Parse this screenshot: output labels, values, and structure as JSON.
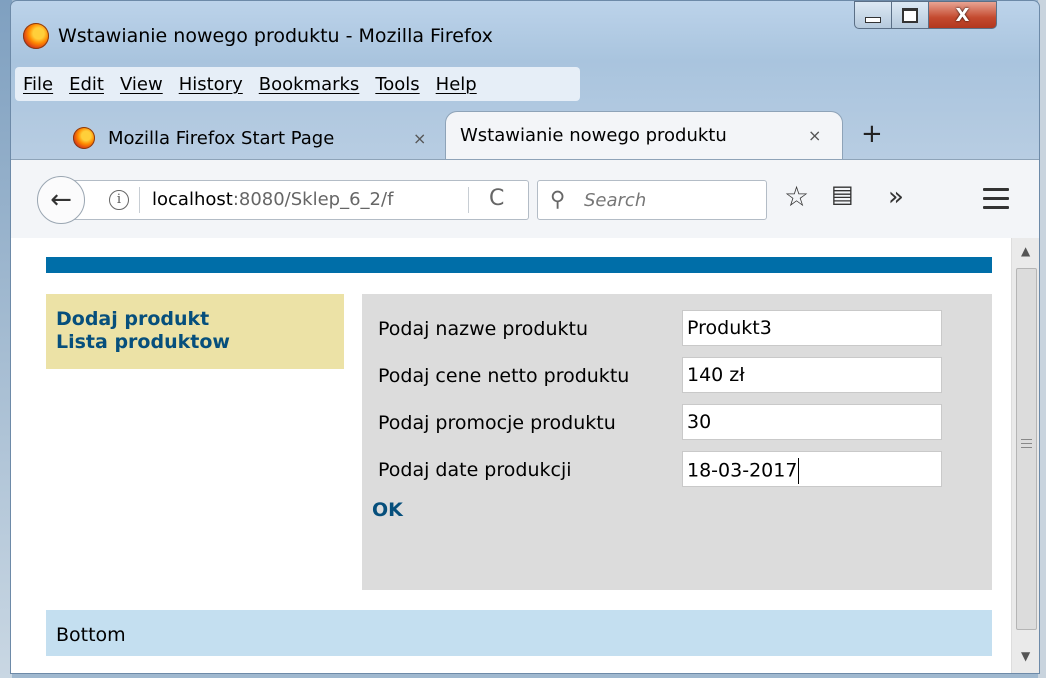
{
  "window": {
    "title": "Wstawianie nowego produktu - Mozilla Firefox",
    "minimize_icon": "minimize-icon",
    "maximize_icon": "maximize-icon",
    "close_glyph": "X"
  },
  "menu": [
    "File",
    "Edit",
    "View",
    "History",
    "Bookmarks",
    "Tools",
    "Help"
  ],
  "tabs": [
    {
      "label": "Mozilla Firefox Start Page",
      "active": false
    },
    {
      "label": "Wstawianie nowego produktu",
      "active": true
    }
  ],
  "tab_close_glyph": "×",
  "new_tab_glyph": "+",
  "nav": {
    "back_glyph": "←",
    "info_glyph": "i",
    "url_host": "localhost",
    "url_path": ":8080/Sklep_6_2/f",
    "reload_glyph": "C",
    "search_placeholder": "Search",
    "search_glyph": "⚲",
    "star_glyph": "☆",
    "reader_glyph": "▤",
    "overflow_glyph": "»"
  },
  "page": {
    "accent_color": "#006ea8",
    "sidemenu": [
      "Dodaj produkt",
      "Lista produktow"
    ],
    "form": {
      "fields": [
        {
          "label": "Podaj nazwe produktu",
          "value": "Produkt3"
        },
        {
          "label": "Podaj cene netto produktu",
          "value": "140 zł"
        },
        {
          "label": "Podaj promocje produktu",
          "value": "30"
        },
        {
          "label": "Podaj date produkcji",
          "value": "18-03-2017"
        }
      ],
      "submit_label": "OK"
    },
    "footer": "Bottom"
  },
  "scrollbar": {
    "up_glyph": "▲",
    "down_glyph": "▼"
  }
}
